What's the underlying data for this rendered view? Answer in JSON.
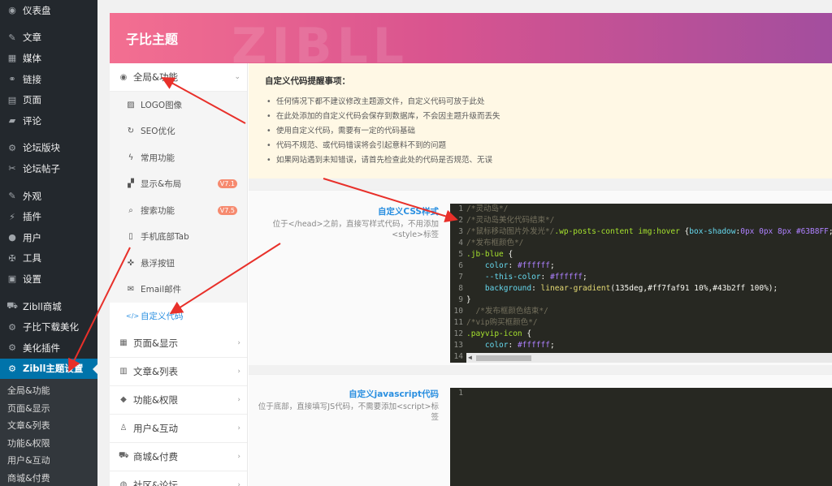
{
  "sidebar": {
    "items": [
      {
        "label": "仪表盘",
        "icon": "dashboard-icon",
        "glyph": "◉"
      },
      {
        "sep": true
      },
      {
        "label": "文章",
        "icon": "pin-icon",
        "glyph": "✎"
      },
      {
        "label": "媒体",
        "icon": "media-icon",
        "glyph": "▦"
      },
      {
        "label": "链接",
        "icon": "link-icon",
        "glyph": "⚭"
      },
      {
        "label": "页面",
        "icon": "page-icon",
        "glyph": "▤"
      },
      {
        "label": "评论",
        "icon": "comment-icon",
        "glyph": "▰"
      },
      {
        "sep": true
      },
      {
        "label": "论坛版块",
        "icon": "forum-icon",
        "glyph": "⚙"
      },
      {
        "label": "论坛帖子",
        "icon": "post-icon",
        "glyph": "✂"
      },
      {
        "sep": true
      },
      {
        "label": "外观",
        "icon": "brush-icon",
        "glyph": "✎"
      },
      {
        "label": "插件",
        "icon": "plugin-icon",
        "glyph": "⚡"
      },
      {
        "label": "用户",
        "icon": "user-icon",
        "glyph": "●"
      },
      {
        "label": "工具",
        "icon": "wrench-icon",
        "glyph": "✠"
      },
      {
        "label": "设置",
        "icon": "settings-icon",
        "glyph": "▣"
      },
      {
        "sep": true
      },
      {
        "label": "Zibll商城",
        "icon": "cart-icon",
        "glyph": "⛟"
      },
      {
        "label": "子比下载美化",
        "icon": "gear-icon",
        "glyph": "⚙"
      },
      {
        "label": "美化插件",
        "icon": "gear-icon",
        "glyph": "⚙"
      },
      {
        "label": "Zibll主题设置",
        "icon": "gear-icon",
        "glyph": "⚙",
        "active": true
      }
    ],
    "submenu": [
      "全局&功能",
      "页面&显示",
      "文章&列表",
      "功能&权限",
      "用户&互动",
      "商城&付费"
    ]
  },
  "panel": {
    "title": "子比主题",
    "watermark": "ZIBLL"
  },
  "nav": {
    "groups_top": {
      "label": "全局&功能",
      "icon": "globe-icon",
      "glyph": "◉",
      "chev": "⌄"
    },
    "sub": [
      {
        "label": "LOGO图像",
        "icon": "image-icon",
        "glyph": "▨"
      },
      {
        "label": "SEO优化",
        "icon": "seo-icon",
        "glyph": "↻"
      },
      {
        "label": "常用功能",
        "icon": "bolt-icon",
        "glyph": "ϟ"
      },
      {
        "label": "显示&布局",
        "icon": "layout-icon",
        "glyph": "▞",
        "badge": "V7.1"
      },
      {
        "label": "搜索功能",
        "icon": "search-icon",
        "glyph": "⌕",
        "badge": "V7.5"
      },
      {
        "label": "手机底部Tab",
        "icon": "mobile-icon",
        "glyph": "▯"
      },
      {
        "label": "悬浮按钮",
        "icon": "thumbtack-icon",
        "glyph": "✜"
      },
      {
        "label": "Email邮件",
        "icon": "mail-icon",
        "glyph": "✉"
      },
      {
        "label": "自定义代码",
        "icon": "code-icon",
        "glyph": "</>",
        "active": true
      }
    ],
    "groups": [
      {
        "label": "页面&显示",
        "icon": "calendar-icon",
        "glyph": "▦",
        "chev": "›"
      },
      {
        "label": "文章&列表",
        "icon": "map-icon",
        "glyph": "▥",
        "chev": "›"
      },
      {
        "label": "功能&权限",
        "icon": "shield-icon",
        "glyph": "◆",
        "chev": "›"
      },
      {
        "label": "用户&互动",
        "icon": "user-icon",
        "glyph": "♙",
        "chev": "›"
      },
      {
        "label": "商城&付费",
        "icon": "cart-icon",
        "glyph": "⛟",
        "chev": "›"
      },
      {
        "label": "社区&论坛",
        "icon": "forum-icon",
        "glyph": "◍",
        "chev": "›"
      }
    ]
  },
  "notice": {
    "title": "自定义代码提醒事项：",
    "items": [
      "任何情况下都不建议修改主题源文件，自定义代码可放于此处",
      "在此处添加的自定义代码会保存到数据库，不会因主题升级而丢失",
      "使用自定义代码，需要有一定的代码基础",
      "代码不规范、或代码错误将会引起意料不到的问题",
      "如果网站遇到未知错误，请首先检查此处的代码是否规范、无误"
    ]
  },
  "css_field": {
    "title": "自定义CSS样式",
    "desc": "位于</head>之前，直接写样式代码，不用添加<style>标签",
    "lines": [
      [
        [
          "c-com",
          "/*灵动岛*/"
        ]
      ],
      [
        [
          "c-com",
          "/*灵动岛美化代码结束*/"
        ]
      ],
      [
        [
          "c-com",
          "/*鼠标移动图片外发光*/"
        ],
        [
          "c-sel",
          ".wp-posts-content img:hover"
        ],
        [
          "c-plain",
          " {"
        ],
        [
          "c-prop",
          "box-shadow"
        ],
        [
          "c-plain",
          ":"
        ],
        [
          "c-val",
          "0px 0px 8px #63B8FF"
        ],
        [
          "c-plain",
          ";}"
        ]
      ],
      [
        [
          "c-com",
          "/*发布框颜色*/"
        ]
      ],
      [
        [
          "c-sel",
          ".jb-blue"
        ],
        [
          "c-plain",
          " {"
        ]
      ],
      [
        [
          "c-plain",
          "    "
        ],
        [
          "c-prop",
          "color"
        ],
        [
          "c-plain",
          ": "
        ],
        [
          "c-val",
          "#ffffff"
        ],
        [
          "c-plain",
          ";"
        ]
      ],
      [
        [
          "c-plain",
          "    "
        ],
        [
          "c-prop",
          "--this-color"
        ],
        [
          "c-plain",
          ": "
        ],
        [
          "c-val",
          "#ffffff"
        ],
        [
          "c-plain",
          ";"
        ]
      ],
      [
        [
          "c-plain",
          "    "
        ],
        [
          "c-prop",
          "background"
        ],
        [
          "c-plain",
          ": "
        ],
        [
          "c-str",
          "linear-gradient"
        ],
        [
          "c-plain",
          "(135deg,#ff7faf91 10%,#43b2ff 100%);"
        ]
      ],
      [
        [
          "c-plain",
          "}"
        ]
      ],
      [
        [
          "c-plain",
          "  "
        ],
        [
          "c-com",
          "/*发布框颜色结束*/"
        ]
      ],
      [
        [
          "c-com",
          "/*vip购买框颜色*/"
        ]
      ],
      [
        [
          "c-sel",
          ".payvip-icon"
        ],
        [
          "c-plain",
          " {"
        ]
      ],
      [
        [
          "c-plain",
          "    "
        ],
        [
          "c-prop",
          "color"
        ],
        [
          "c-plain",
          ": "
        ],
        [
          "c-val",
          "#ffffff"
        ],
        [
          "c-plain",
          ";"
        ]
      ],
      [
        [
          "c-plain",
          ""
        ]
      ]
    ]
  },
  "js_field": {
    "title": "自定义javascript代码",
    "desc": "位于底部，直接填写JS代码，不需要添加<script>标签",
    "lines": [
      [
        [
          "c-plain",
          ""
        ]
      ]
    ]
  },
  "colors": {
    "annotation_arrow": "#e8302a",
    "active_menu": "#0073aa",
    "link_blue": "#2a8fe0"
  }
}
